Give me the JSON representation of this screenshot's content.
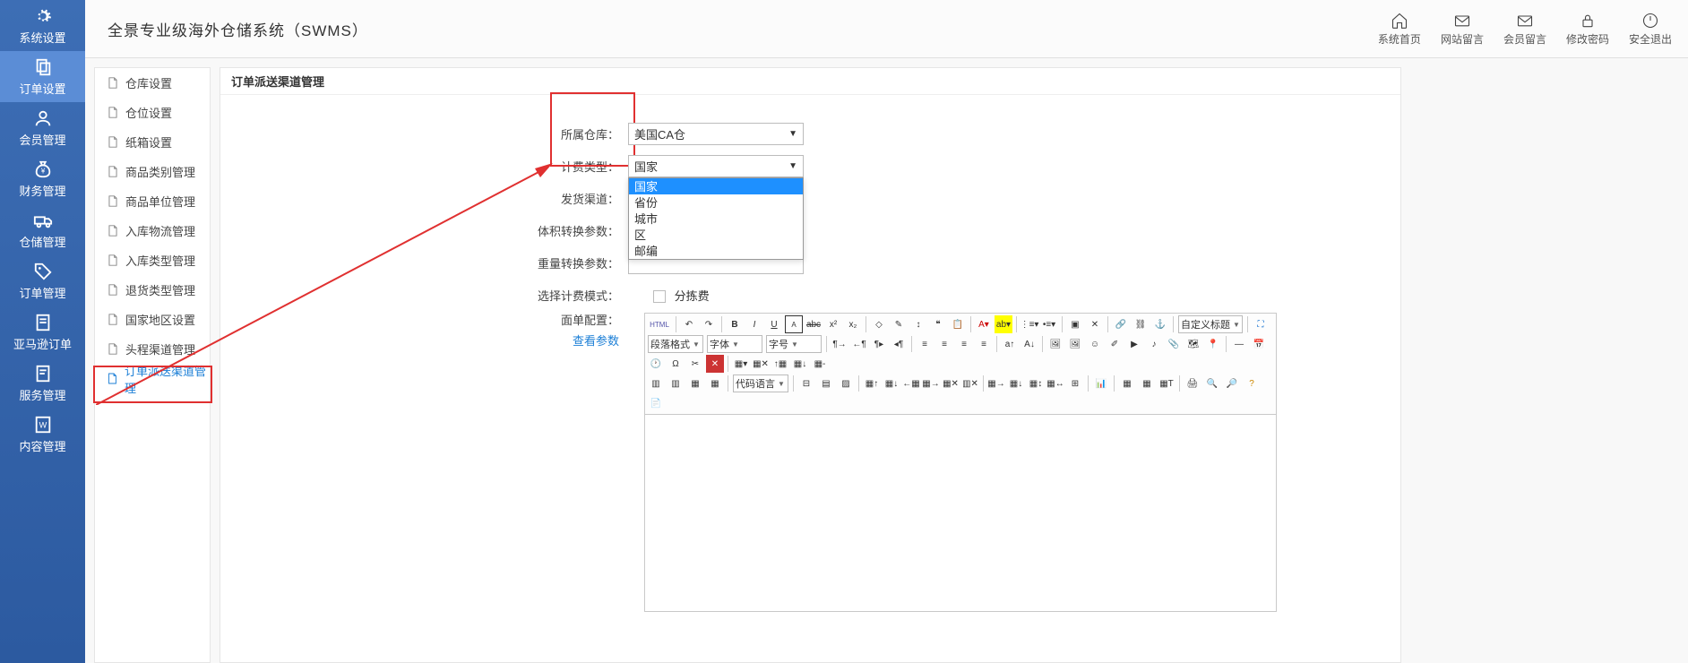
{
  "header": {
    "title": "全景专业级海外仓储系统（SWMS）",
    "actions": [
      {
        "key": "home",
        "label": "系统首页"
      },
      {
        "key": "site-msg",
        "label": "网站留言"
      },
      {
        "key": "member-msg",
        "label": "会员留言"
      },
      {
        "key": "change-pwd",
        "label": "修改密码"
      },
      {
        "key": "logout",
        "label": "安全退出"
      }
    ]
  },
  "vnav": [
    {
      "key": "system",
      "label": "系统设置"
    },
    {
      "key": "order-settings",
      "label": "订单设置"
    },
    {
      "key": "member",
      "label": "会员管理"
    },
    {
      "key": "finance",
      "label": "财务管理"
    },
    {
      "key": "warehouse",
      "label": "仓储管理"
    },
    {
      "key": "order",
      "label": "订单管理"
    },
    {
      "key": "amazon",
      "label": "亚马逊订单"
    },
    {
      "key": "service",
      "label": "服务管理"
    },
    {
      "key": "content",
      "label": "内容管理"
    }
  ],
  "vnav_active": 1,
  "sidemenu": [
    "仓库设置",
    "仓位设置",
    "纸箱设置",
    "商品类别管理",
    "商品单位管理",
    "入库物流管理",
    "入库类型管理",
    "退货类型管理",
    "国家地区设置",
    "头程渠道管理",
    "订单派送渠道管理"
  ],
  "sidemenu_active": 10,
  "content": {
    "title": "订单派送渠道管理",
    "fields": {
      "warehouse": {
        "label": "所属仓库：",
        "value": "美国CA仓"
      },
      "billing_type": {
        "label": "计费类型：",
        "value": "国家"
      },
      "ship_channel": {
        "label": "发货渠道："
      },
      "volume_param": {
        "label": "体积转换参数："
      },
      "weight_param": {
        "label": "重量转换参数："
      },
      "billing_mode": {
        "label": "选择计费模式：",
        "checkbox_label": "分拣费"
      },
      "sheet_config": {
        "label": "面单配置：",
        "link": "查看参数"
      }
    },
    "billing_type_options": [
      "国家",
      "省份",
      "城市",
      "区",
      "邮编"
    ],
    "billing_type_selected": 0
  },
  "editor": {
    "para_sel": "段落格式",
    "font_sel": "字体",
    "size_sel": "字号",
    "title_sel": "自定义标题",
    "lang_sel": "代码语言",
    "html_btn": "HTML"
  }
}
